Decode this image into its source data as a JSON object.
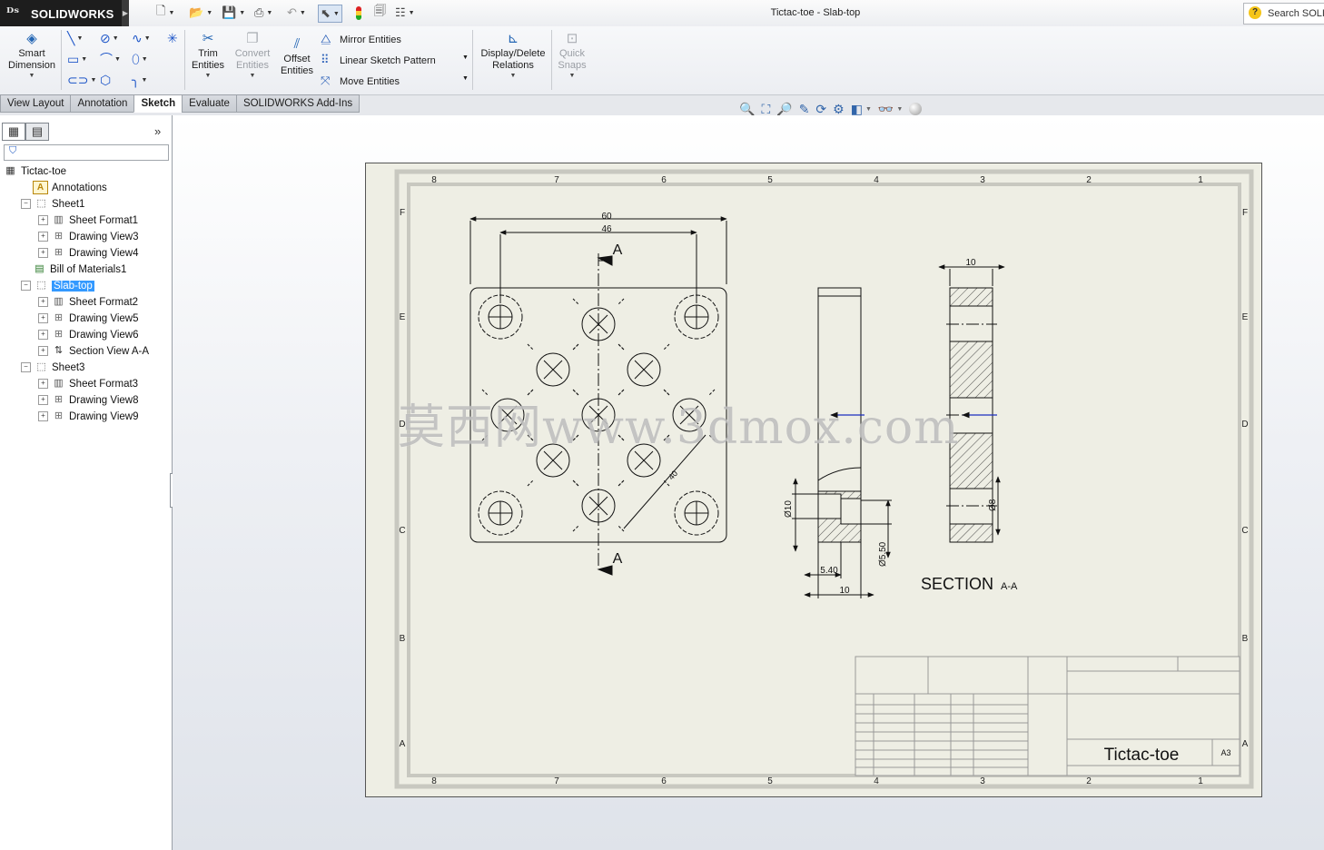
{
  "app": {
    "brand": "SOLIDWORKS",
    "window_title": "Tictac-toe - Slab-top",
    "search_placeholder": "Search SOLI"
  },
  "ribbon": {
    "smart_dimension": [
      "Smart",
      "Dimension"
    ],
    "trim": [
      "Trim",
      "Entities"
    ],
    "convert": [
      "Convert",
      "Entities"
    ],
    "offset": [
      "Offset",
      "Entities"
    ],
    "mirror": "Mirror Entities",
    "linear_pattern": "Linear Sketch Pattern",
    "move": "Move Entities",
    "relations": [
      "Display/Delete",
      "Relations"
    ],
    "snaps": [
      "Quick",
      "Snaps"
    ]
  },
  "tabs": [
    "View Layout",
    "Annotation",
    "Sketch",
    "Evaluate",
    "SOLIDWORKS Add-Ins"
  ],
  "active_tab": "Sketch",
  "tree": [
    {
      "label": "Tictac-toe",
      "indent": 0,
      "icon": "drawing-icon",
      "expander": ""
    },
    {
      "label": "Annotations",
      "indent": 1,
      "icon": "annotations-icon",
      "expander": ""
    },
    {
      "label": "Sheet1",
      "indent": 1,
      "icon": "sheet-icon",
      "expander": "−"
    },
    {
      "label": "Sheet Format1",
      "indent": 2,
      "icon": "sheet-format-icon",
      "expander": "+"
    },
    {
      "label": "Drawing View3",
      "indent": 2,
      "icon": "drawing-view-icon",
      "expander": "+"
    },
    {
      "label": "Drawing View4",
      "indent": 2,
      "icon": "drawing-view-icon",
      "expander": "+"
    },
    {
      "label": "Bill of Materials1",
      "indent": 1,
      "icon": "bom-icon",
      "expander": ""
    },
    {
      "label": "Slab-top",
      "indent": 1,
      "icon": "sheet-icon",
      "expander": "−",
      "selected": true
    },
    {
      "label": "Sheet Format2",
      "indent": 2,
      "icon": "sheet-format-icon",
      "expander": "+"
    },
    {
      "label": "Drawing View5",
      "indent": 2,
      "icon": "drawing-view-icon",
      "expander": "+"
    },
    {
      "label": "Drawing View6",
      "indent": 2,
      "icon": "drawing-view-icon",
      "expander": "+"
    },
    {
      "label": "Section View A-A",
      "indent": 2,
      "icon": "section-view-icon",
      "expander": "+"
    },
    {
      "label": "Sheet3",
      "indent": 1,
      "icon": "sheet-icon",
      "expander": "−"
    },
    {
      "label": "Sheet Format3",
      "indent": 2,
      "icon": "sheet-format-icon",
      "expander": "+"
    },
    {
      "label": "Drawing View8",
      "indent": 2,
      "icon": "drawing-view-icon",
      "expander": "+"
    },
    {
      "label": "Drawing View9",
      "indent": 2,
      "icon": "drawing-view-icon",
      "expander": "+"
    }
  ],
  "drawing": {
    "zones_top": [
      "8",
      "7",
      "6",
      "5",
      "4",
      "3",
      "2",
      "1"
    ],
    "zones_side": [
      "F",
      "E",
      "D",
      "C",
      "B",
      "A"
    ],
    "dims": {
      "w60": "60",
      "w46": "46",
      "w10": "10",
      "d10": "Ø10",
      "d550": "Ø5.50",
      "t540": "5.40",
      "b10": "10",
      "d8": "Ø8",
      "diag": "40"
    },
    "section_letter": "A",
    "section_title": "SECTION",
    "section_suffix": "A-A",
    "title_block": {
      "name": "Tictac-toe",
      "size": "A3"
    }
  },
  "watermark": "莫西网www.3dmox.com"
}
